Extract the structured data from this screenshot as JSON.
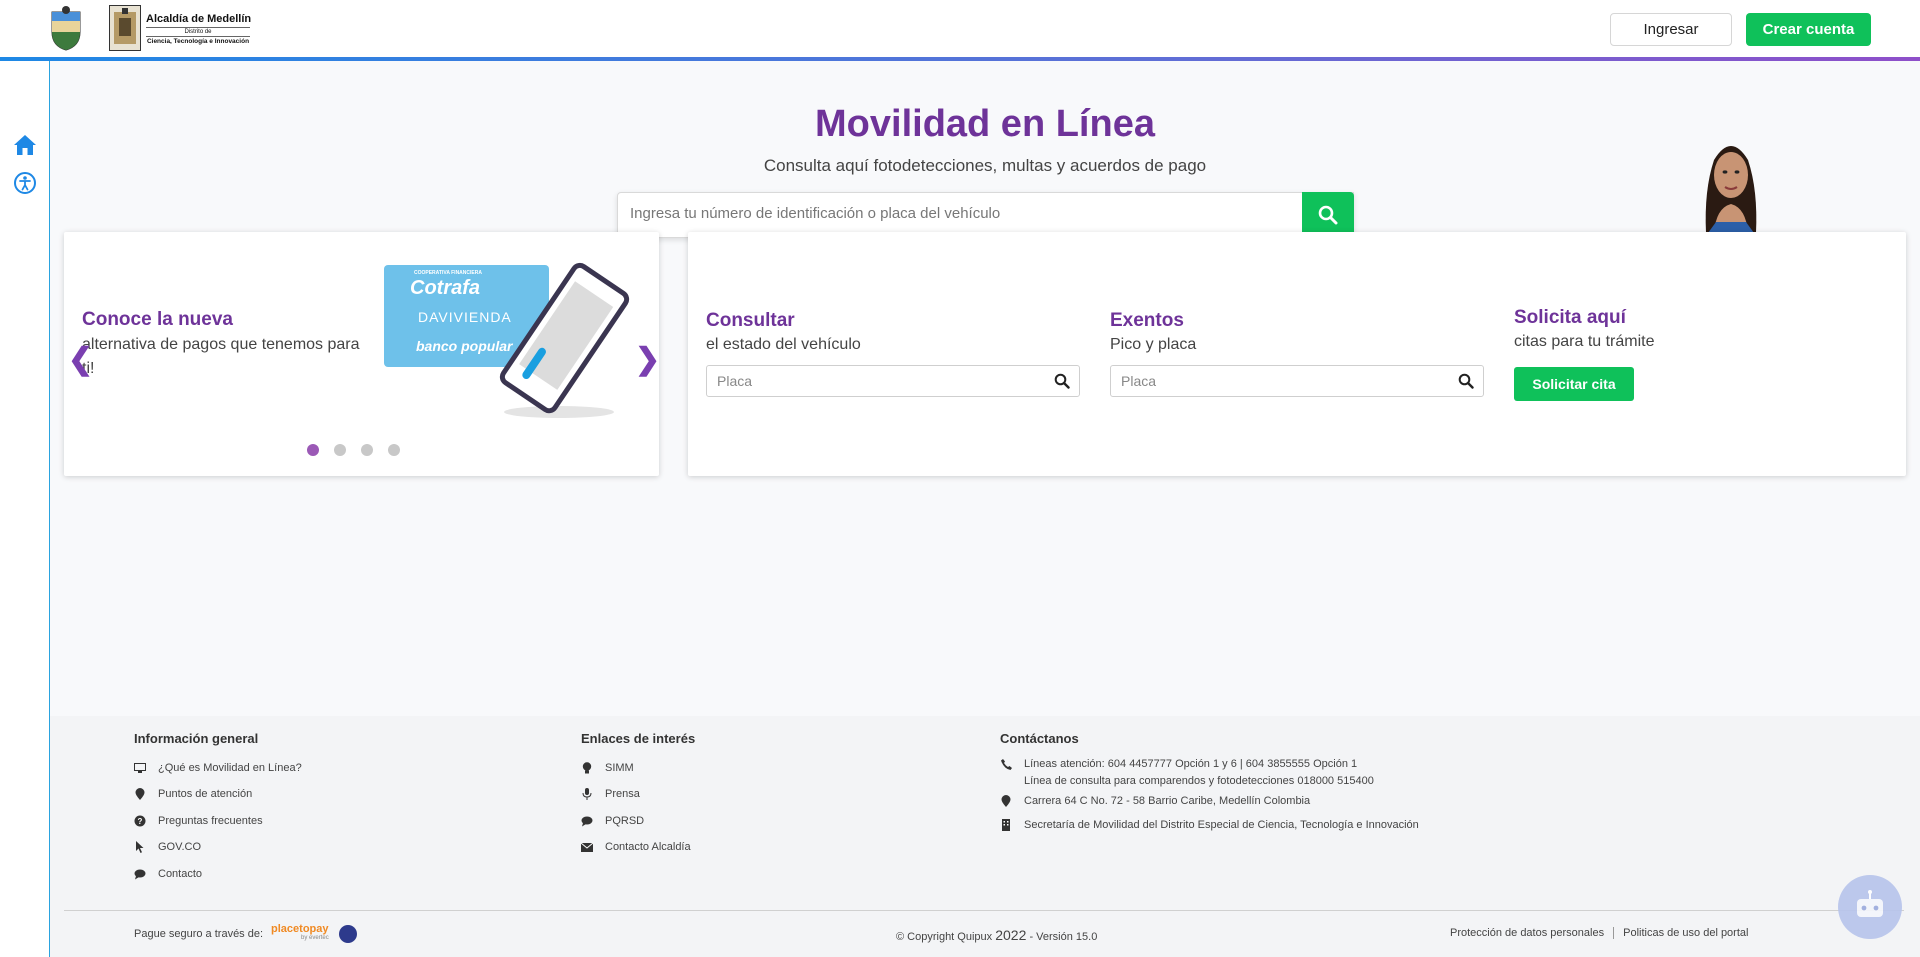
{
  "header": {
    "logo_title": "Alcaldía de Medellín",
    "logo_district": "Distrito de",
    "logo_subtitle": "Ciencia, Tecnología e Innovación",
    "login_label": "Ingresar",
    "create_label": "Crear cuenta"
  },
  "hero": {
    "title": "Movilidad en Línea",
    "subtitle": "Consulta aquí fotodetecciones, multas y acuerdos de pago",
    "search_placeholder": "Ingresa tu número de identificación o placa del vehículo"
  },
  "carousel": {
    "title": "Conoce la nueva",
    "text": "alternativa de pagos que tenemos para ti!",
    "prev": "❮",
    "next": "❯",
    "banks": [
      "Cotrafa",
      "DAVIVIENDA",
      "banco popular"
    ],
    "bank_caption": "COOPERATIVA FINANCIERA",
    "slide_count": 4,
    "active_slide": 1
  },
  "consultar": {
    "title": "Consultar",
    "subtitle": "el estado del vehículo",
    "placeholder": "Placa"
  },
  "exentos": {
    "title": "Exentos",
    "subtitle": "Pico y placa",
    "placeholder": "Placa"
  },
  "cita": {
    "title": "Solicita aquí",
    "subtitle": "citas para tu trámite",
    "button": "Solicitar cita"
  },
  "footer": {
    "info_title": "Información general",
    "info_items": [
      "¿Qué es Movilidad en Línea?",
      "Puntos de atención",
      "Preguntas frecuentes",
      "GOV.CO",
      "Contacto"
    ],
    "links_title": "Enlaces de interés",
    "links_items": [
      "SIMM",
      "Prensa",
      "PQRSD",
      "Contacto Alcaldía"
    ],
    "contact_title": "Contáctanos",
    "contact_line1": "Líneas atención: 604 4457777 Opción 1 y 6 | 604 3855555 Opción 1",
    "contact_line2": "Línea de consulta para comparendos y fotodetecciones 018000 515400",
    "address": "Carrera 64 C No. 72 - 58 Barrio Caribe, Medellín Colombia",
    "secretaria": "Secretaría de Movilidad del Distrito Especial de Ciencia, Tecnología e Innovación",
    "pay_label": "Pague seguro a través de:",
    "pay_brand": "placetopay",
    "pay_brand_sub": "by evertec",
    "copyright_prefix": "© Copyright Quipux",
    "copyright_year": "2022",
    "copyright_suffix": "- Versión 15.0",
    "privacy": "Protección de datos personales",
    "policies": "Politicas de uso del portal"
  },
  "colors": {
    "brand_purple": "#6e3399",
    "accent_green": "#0fc15a",
    "accent_blue": "#1e88e5"
  }
}
